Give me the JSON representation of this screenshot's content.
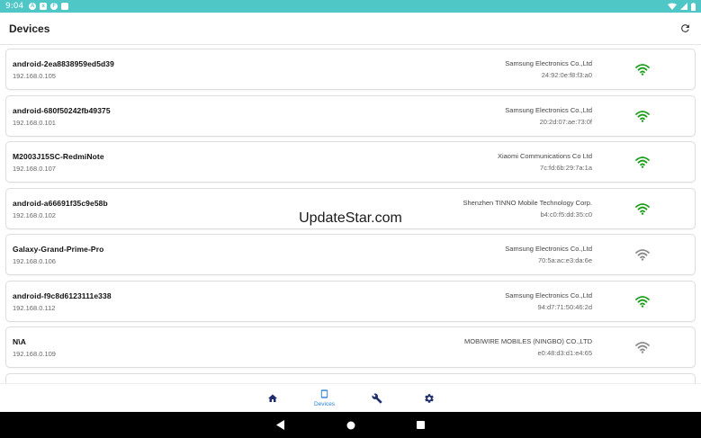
{
  "status_bar": {
    "time": "9:04"
  },
  "app_bar": {
    "title": "Devices",
    "refresh_icon": "refresh-icon"
  },
  "devices": [
    {
      "name": "android-2ea8838959ed5d39",
      "ip": "192.168.0.105",
      "vendor": "Samsung Electronics Co.,Ltd",
      "mac": "24:92:0e:f8:f3:a0",
      "signal": "strong"
    },
    {
      "name": "android-680f50242fb49375",
      "ip": "192.168.0.101",
      "vendor": "Samsung Electronics Co.,Ltd",
      "mac": "20:2d:07:ae:73:0f",
      "signal": "strong"
    },
    {
      "name": "M2003J15SC-RedmiNote",
      "ip": "192.168.0.107",
      "vendor": "Xiaomi Communications Co Ltd",
      "mac": "7c:fd:6b:29:7a:1a",
      "signal": "strong"
    },
    {
      "name": "android-a66691f35c9e58b",
      "ip": "192.168.0.102",
      "vendor": "Shenzhen TINNO Mobile Technology Corp.",
      "mac": "b4:c0:f5:dd:35:c0",
      "signal": "strong"
    },
    {
      "name": "Galaxy-Grand-Prime-Pro",
      "ip": "192.168.0.106",
      "vendor": "Samsung Electronics Co.,Ltd",
      "mac": "70:5a:ac:e3:da:6e",
      "signal": "weak"
    },
    {
      "name": "android-f9c8d6123111e338",
      "ip": "192.168.0.112",
      "vendor": "Samsung Electronics Co.,Ltd",
      "mac": "94:d7:71:50:46:2d",
      "signal": "strong"
    },
    {
      "name": "N\\A",
      "ip": "192.168.0.109",
      "vendor": "MOBIWIRE MOBILES (NINGBO) CO.,LTD",
      "mac": "e0:48:d3:d1:e4:65",
      "signal": "weak"
    },
    {
      "name": "",
      "ip": "",
      "vendor": "",
      "mac": "",
      "signal": "none"
    }
  ],
  "watermark": "UpdateStar.com",
  "bottom_nav": {
    "items": [
      {
        "icon": "home-icon",
        "label": ""
      },
      {
        "icon": "tablet-icon",
        "label": "Devices",
        "active": true
      },
      {
        "icon": "wrench-icon",
        "label": ""
      },
      {
        "icon": "gear-icon",
        "label": ""
      }
    ]
  },
  "colors": {
    "status_bar": "#4fc7c7",
    "signal_strong": "#1a9e1a",
    "signal_weak": "#8a8a8a",
    "nav_icon": "#1f2d6b",
    "nav_active": "#2a7fd4"
  }
}
